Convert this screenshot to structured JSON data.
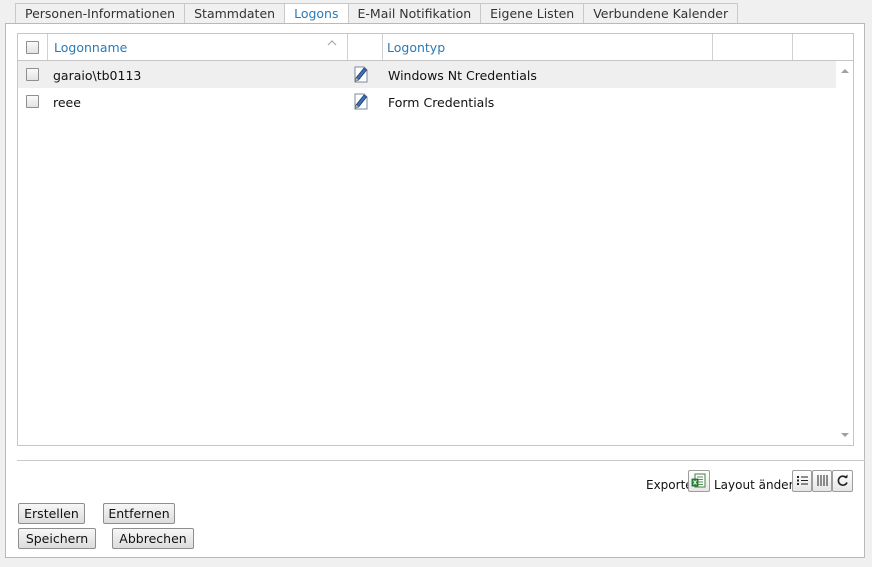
{
  "tabs": [
    {
      "label": "Personen-Informationen",
      "active": false
    },
    {
      "label": "Stammdaten",
      "active": false
    },
    {
      "label": "Logons",
      "active": true
    },
    {
      "label": "E-Mail Notifikation",
      "active": false
    },
    {
      "label": "Eigene Listen",
      "active": false
    },
    {
      "label": "Verbundene Kalender",
      "active": false
    }
  ],
  "grid": {
    "columns": {
      "logonname": "Logonname",
      "logontyp": "Logontyp"
    },
    "sort": {
      "column": "logonname",
      "direction": "ascending"
    },
    "rows": [
      {
        "logonname": "garaio\\tb0113",
        "logontyp": "Windows Nt Credentials",
        "checked": false
      },
      {
        "logonname": "reee",
        "logontyp": "Form Credentials",
        "checked": false
      }
    ]
  },
  "toolbar": {
    "export_label": "Exporte",
    "layout_label": "Layout ändern"
  },
  "icons": {
    "export": "excel-export-icon",
    "layout_list": "list-view-icon",
    "layout_columns": "columns-view-icon",
    "layout_refresh": "refresh-icon",
    "edit": "edit-pencil-icon",
    "sort": "sort-ascending-icon"
  },
  "buttons": {
    "create": "Erstellen",
    "remove": "Entfernen",
    "save": "Speichern",
    "cancel": "Abbrechen"
  },
  "colors": {
    "accent": "#2a7ab8",
    "row_alt": "#efefef",
    "border": "#c6c6c6"
  }
}
